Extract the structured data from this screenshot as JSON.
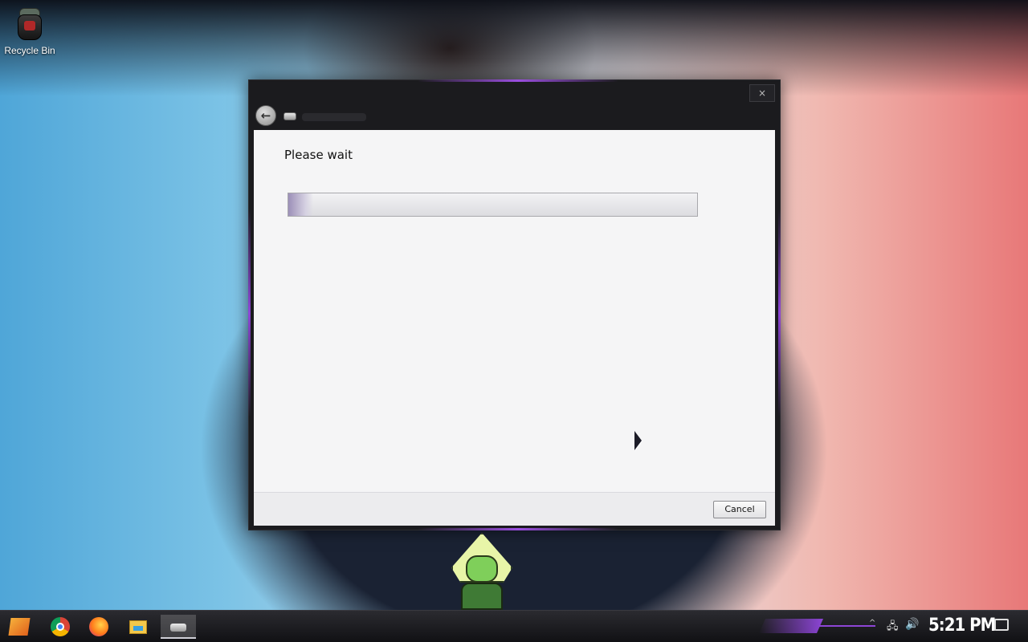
{
  "desktop": {
    "recycle_bin_label": "Recycle Bin"
  },
  "dialog": {
    "close_glyph": "×",
    "back_glyph": "←",
    "heading": "Please wait",
    "progress_percent": 6,
    "cancel_label": "Cancel"
  },
  "taskbar": {
    "pinned": [
      "start-icon",
      "chrome-icon",
      "firefox-icon",
      "file-explorer-icon",
      "drive-app-icon"
    ],
    "clock": "5:21 PM",
    "tray_chevron": "^",
    "network_glyph": "🖧",
    "volume_glyph": "🔊"
  },
  "colors": {
    "accent": "#8d45d6",
    "window_bg": "#1b1b1e",
    "content_bg": "#f5f5f6"
  }
}
